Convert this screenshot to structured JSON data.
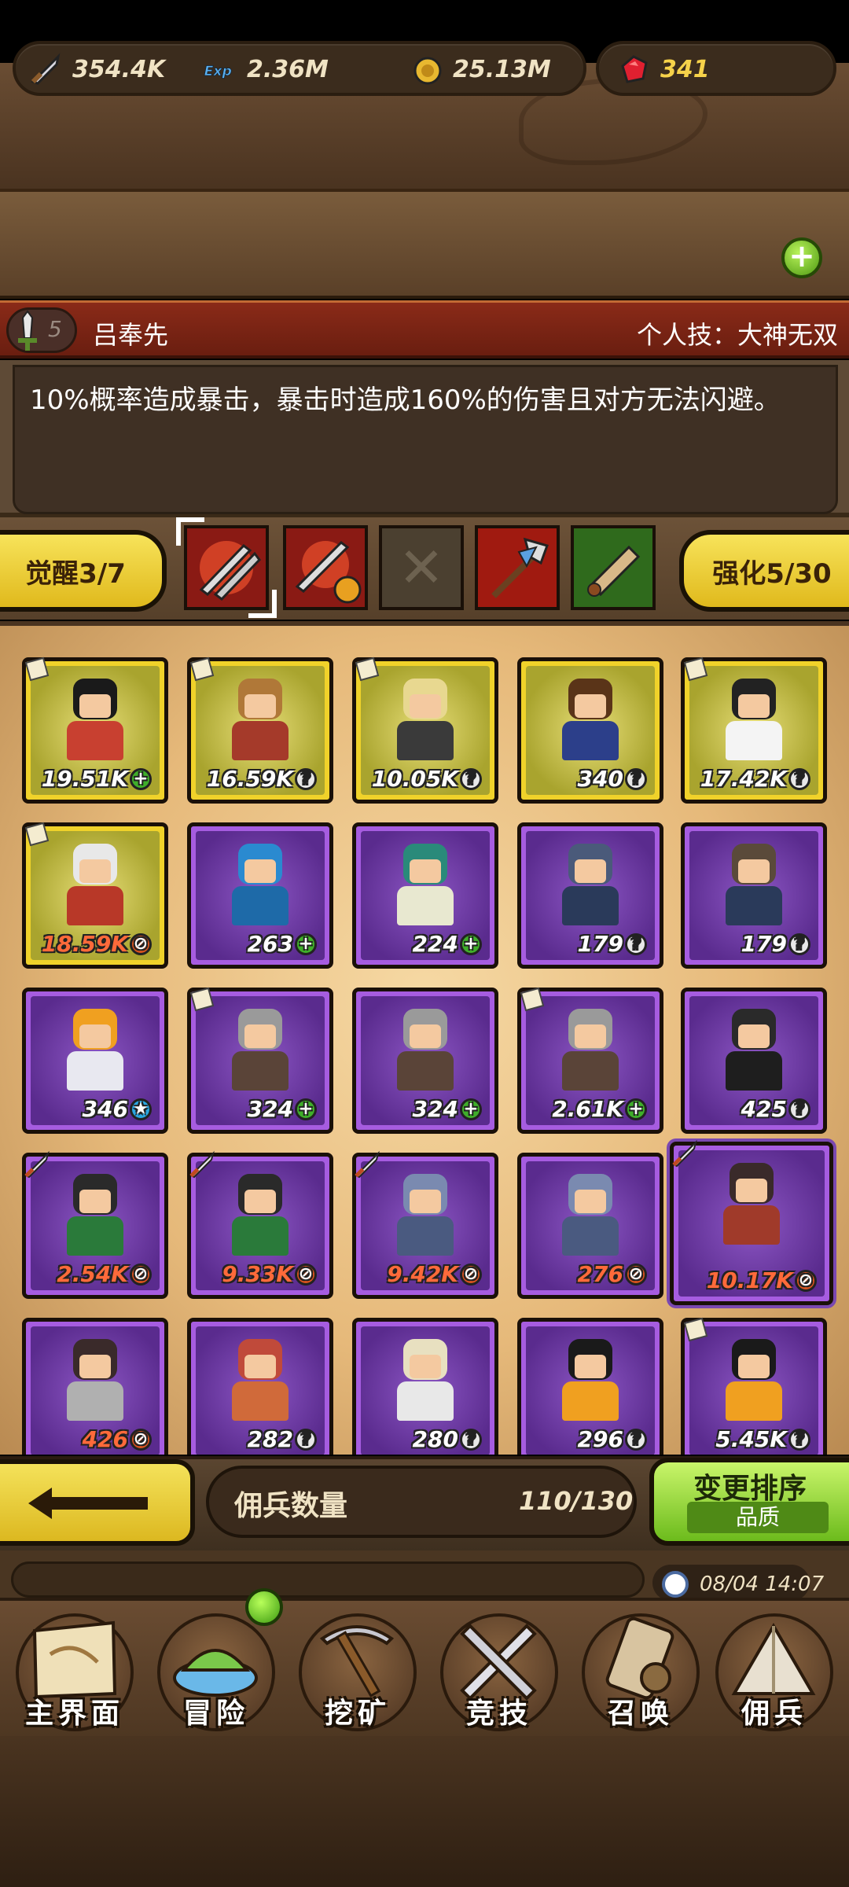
{
  "resources": {
    "attack": {
      "icon": "sword-icon",
      "value": "354.4K"
    },
    "exp": {
      "icon": "exp-icon",
      "value": "2.36M"
    },
    "gold": {
      "icon": "gold-coin-icon",
      "value": "25.13M"
    },
    "gems": {
      "icon": "ruby-gem-icon",
      "value": "341"
    },
    "add_label": "+"
  },
  "skill": {
    "level": "5",
    "name": "吕奉先",
    "type_label": "个人技：大神无双",
    "description": "10%概率造成暴击，暴击时造成160%的伤害且对方无法闪避。"
  },
  "awaken_label": "觉醒3/7",
  "enhance_label": "强化5/30",
  "empty_slot_glyph": "✕",
  "heroes": [
    {
      "power": "19.51K",
      "badge": "up",
      "frame": "gold",
      "hair": "#1a1a1a",
      "outfit": "#c84030",
      "tag": "scroll"
    },
    {
      "power": "16.59K",
      "badge": "q",
      "frame": "gold",
      "hair": "#b07838",
      "outfit": "#a53a2a",
      "tag": "scroll"
    },
    {
      "power": "10.05K",
      "badge": "q",
      "frame": "gold",
      "hair": "#e8d890",
      "outfit": "#3a3a3a",
      "tag": "scroll"
    },
    {
      "power": "340",
      "badge": "q",
      "frame": "gold",
      "hair": "#5a3418",
      "outfit": "#2c3f8a",
      "tag": ""
    },
    {
      "power": "17.42K",
      "badge": "q",
      "frame": "gold",
      "hair": "#222222",
      "outfit": "#f4f4f4",
      "tag": "scroll"
    },
    {
      "power": "18.59K",
      "badge": "down",
      "frame": "gold",
      "hair": "#e8e8e8",
      "outfit": "#b83828",
      "tag": "scroll",
      "red": true
    },
    {
      "power": "263",
      "badge": "up",
      "frame": "purple",
      "hair": "#2a8ad0",
      "outfit": "#1e6aa8",
      "tag": ""
    },
    {
      "power": "224",
      "badge": "up",
      "frame": "purple",
      "hair": "#2a8a7a",
      "outfit": "#e8e8d0",
      "tag": ""
    },
    {
      "power": "179",
      "badge": "q",
      "frame": "purple",
      "hair": "#4a5a7a",
      "outfit": "#2a3a5a",
      "tag": ""
    },
    {
      "power": "179",
      "badge": "q",
      "frame": "purple",
      "hair": "#5a4a3a",
      "outfit": "#2a3a5a",
      "tag": ""
    },
    {
      "power": "346",
      "badge": "star",
      "frame": "purple",
      "hair": "#f0a020",
      "outfit": "#e8e8f0",
      "tag": ""
    },
    {
      "power": "324",
      "badge": "up",
      "frame": "purple",
      "hair": "#9a9a9a",
      "outfit": "#5a4438",
      "tag": "scroll"
    },
    {
      "power": "324",
      "badge": "up",
      "frame": "purple",
      "hair": "#9a9a9a",
      "outfit": "#5a4438",
      "tag": ""
    },
    {
      "power": "2.61K",
      "badge": "up",
      "frame": "purple",
      "hair": "#9a9a9a",
      "outfit": "#5a4438",
      "tag": "scroll"
    },
    {
      "power": "425",
      "badge": "q",
      "frame": "purple",
      "hair": "#2a2a2a",
      "outfit": "#1e1e1e",
      "tag": ""
    },
    {
      "power": "2.54K",
      "badge": "down",
      "frame": "purple",
      "hair": "#2a2a2a",
      "outfit": "#2a7a3a",
      "tag": "sword",
      "red": true
    },
    {
      "power": "9.33K",
      "badge": "down",
      "frame": "purple",
      "hair": "#2a2a2a",
      "outfit": "#2a7a3a",
      "tag": "sword",
      "red": true
    },
    {
      "power": "9.42K",
      "badge": "down",
      "frame": "purple",
      "hair": "#7a8ab0",
      "outfit": "#4a5a80",
      "tag": "sword",
      "red": true
    },
    {
      "power": "276",
      "badge": "down",
      "frame": "purple",
      "hair": "#7a8ab0",
      "outfit": "#4a5a80",
      "tag": "",
      "red": true
    },
    {
      "power": "10.17K",
      "badge": "down",
      "frame": "purple",
      "hair": "#3a2a2a",
      "outfit": "#a03a2a",
      "tag": "sword",
      "red": true,
      "big": true
    },
    {
      "power": "426",
      "badge": "down",
      "frame": "purple",
      "hair": "#3a2a2a",
      "outfit": "#b0b0b0",
      "tag": "",
      "red": true
    },
    {
      "power": "282",
      "badge": "q",
      "frame": "purple",
      "hair": "#c04a3a",
      "outfit": "#d06a3a",
      "tag": ""
    },
    {
      "power": "280",
      "badge": "q",
      "frame": "purple",
      "hair": "#e8e0c0",
      "outfit": "#e8e8e8",
      "tag": ""
    },
    {
      "power": "296",
      "badge": "q",
      "frame": "purple",
      "hair": "#1a1a1a",
      "outfit": "#f0a020",
      "tag": ""
    },
    {
      "power": "5.45K",
      "badge": "q",
      "frame": "purple",
      "hair": "#1a1a1a",
      "outfit": "#f0a020",
      "tag": "scroll"
    }
  ],
  "mercenary_count": {
    "label": "佣兵数量",
    "value": "110/130"
  },
  "sort_button": {
    "title": "变更排序",
    "subtitle": "品质"
  },
  "timestamp": "08/04 14:07",
  "nav": [
    {
      "label": "主界面",
      "icon": "map-scroll-icon"
    },
    {
      "label": "冒险",
      "icon": "island-icon"
    },
    {
      "label": "挖矿",
      "icon": "pickaxe-icon"
    },
    {
      "label": "竞技",
      "icon": "crossed-swords-icon"
    },
    {
      "label": "召唤",
      "icon": "summon-scroll-icon"
    },
    {
      "label": "佣兵",
      "icon": "tent-icon"
    }
  ]
}
